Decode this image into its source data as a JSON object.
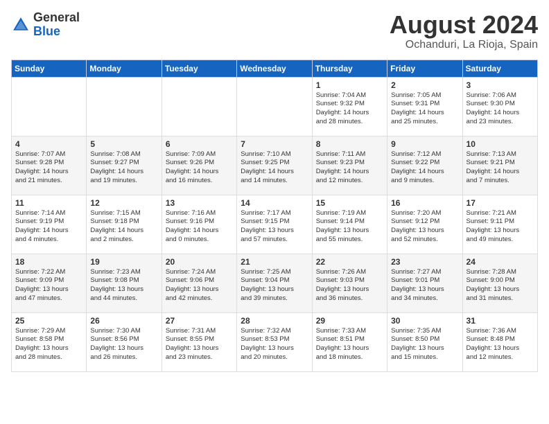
{
  "header": {
    "logo_general": "General",
    "logo_blue": "Blue",
    "month_year": "August 2024",
    "location": "Ochanduri, La Rioja, Spain"
  },
  "days_of_week": [
    "Sunday",
    "Monday",
    "Tuesday",
    "Wednesday",
    "Thursday",
    "Friday",
    "Saturday"
  ],
  "weeks": [
    [
      {
        "day": "",
        "info": ""
      },
      {
        "day": "",
        "info": ""
      },
      {
        "day": "",
        "info": ""
      },
      {
        "day": "",
        "info": ""
      },
      {
        "day": "1",
        "info": "Sunrise: 7:04 AM\nSunset: 9:32 PM\nDaylight: 14 hours\nand 28 minutes."
      },
      {
        "day": "2",
        "info": "Sunrise: 7:05 AM\nSunset: 9:31 PM\nDaylight: 14 hours\nand 25 minutes."
      },
      {
        "day": "3",
        "info": "Sunrise: 7:06 AM\nSunset: 9:30 PM\nDaylight: 14 hours\nand 23 minutes."
      }
    ],
    [
      {
        "day": "4",
        "info": "Sunrise: 7:07 AM\nSunset: 9:28 PM\nDaylight: 14 hours\nand 21 minutes."
      },
      {
        "day": "5",
        "info": "Sunrise: 7:08 AM\nSunset: 9:27 PM\nDaylight: 14 hours\nand 19 minutes."
      },
      {
        "day": "6",
        "info": "Sunrise: 7:09 AM\nSunset: 9:26 PM\nDaylight: 14 hours\nand 16 minutes."
      },
      {
        "day": "7",
        "info": "Sunrise: 7:10 AM\nSunset: 9:25 PM\nDaylight: 14 hours\nand 14 minutes."
      },
      {
        "day": "8",
        "info": "Sunrise: 7:11 AM\nSunset: 9:23 PM\nDaylight: 14 hours\nand 12 minutes."
      },
      {
        "day": "9",
        "info": "Sunrise: 7:12 AM\nSunset: 9:22 PM\nDaylight: 14 hours\nand 9 minutes."
      },
      {
        "day": "10",
        "info": "Sunrise: 7:13 AM\nSunset: 9:21 PM\nDaylight: 14 hours\nand 7 minutes."
      }
    ],
    [
      {
        "day": "11",
        "info": "Sunrise: 7:14 AM\nSunset: 9:19 PM\nDaylight: 14 hours\nand 4 minutes."
      },
      {
        "day": "12",
        "info": "Sunrise: 7:15 AM\nSunset: 9:18 PM\nDaylight: 14 hours\nand 2 minutes."
      },
      {
        "day": "13",
        "info": "Sunrise: 7:16 AM\nSunset: 9:16 PM\nDaylight: 14 hours\nand 0 minutes."
      },
      {
        "day": "14",
        "info": "Sunrise: 7:17 AM\nSunset: 9:15 PM\nDaylight: 13 hours\nand 57 minutes."
      },
      {
        "day": "15",
        "info": "Sunrise: 7:19 AM\nSunset: 9:14 PM\nDaylight: 13 hours\nand 55 minutes."
      },
      {
        "day": "16",
        "info": "Sunrise: 7:20 AM\nSunset: 9:12 PM\nDaylight: 13 hours\nand 52 minutes."
      },
      {
        "day": "17",
        "info": "Sunrise: 7:21 AM\nSunset: 9:11 PM\nDaylight: 13 hours\nand 49 minutes."
      }
    ],
    [
      {
        "day": "18",
        "info": "Sunrise: 7:22 AM\nSunset: 9:09 PM\nDaylight: 13 hours\nand 47 minutes."
      },
      {
        "day": "19",
        "info": "Sunrise: 7:23 AM\nSunset: 9:08 PM\nDaylight: 13 hours\nand 44 minutes."
      },
      {
        "day": "20",
        "info": "Sunrise: 7:24 AM\nSunset: 9:06 PM\nDaylight: 13 hours\nand 42 minutes."
      },
      {
        "day": "21",
        "info": "Sunrise: 7:25 AM\nSunset: 9:04 PM\nDaylight: 13 hours\nand 39 minutes."
      },
      {
        "day": "22",
        "info": "Sunrise: 7:26 AM\nSunset: 9:03 PM\nDaylight: 13 hours\nand 36 minutes."
      },
      {
        "day": "23",
        "info": "Sunrise: 7:27 AM\nSunset: 9:01 PM\nDaylight: 13 hours\nand 34 minutes."
      },
      {
        "day": "24",
        "info": "Sunrise: 7:28 AM\nSunset: 9:00 PM\nDaylight: 13 hours\nand 31 minutes."
      }
    ],
    [
      {
        "day": "25",
        "info": "Sunrise: 7:29 AM\nSunset: 8:58 PM\nDaylight: 13 hours\nand 28 minutes."
      },
      {
        "day": "26",
        "info": "Sunrise: 7:30 AM\nSunset: 8:56 PM\nDaylight: 13 hours\nand 26 minutes."
      },
      {
        "day": "27",
        "info": "Sunrise: 7:31 AM\nSunset: 8:55 PM\nDaylight: 13 hours\nand 23 minutes."
      },
      {
        "day": "28",
        "info": "Sunrise: 7:32 AM\nSunset: 8:53 PM\nDaylight: 13 hours\nand 20 minutes."
      },
      {
        "day": "29",
        "info": "Sunrise: 7:33 AM\nSunset: 8:51 PM\nDaylight: 13 hours\nand 18 minutes."
      },
      {
        "day": "30",
        "info": "Sunrise: 7:35 AM\nSunset: 8:50 PM\nDaylight: 13 hours\nand 15 minutes."
      },
      {
        "day": "31",
        "info": "Sunrise: 7:36 AM\nSunset: 8:48 PM\nDaylight: 13 hours\nand 12 minutes."
      }
    ]
  ]
}
